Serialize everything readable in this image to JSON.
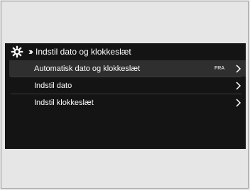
{
  "header": {
    "title": "Indstil dato og klokkeslæt",
    "icon": "gear-icon",
    "nav_icon": "double-chevron-icon"
  },
  "items": [
    {
      "label": "Automatisk dato og klokkeslæt",
      "value": "FRA"
    },
    {
      "label": "Indstil dato",
      "value": ""
    },
    {
      "label": "Indstil klokkeslæt",
      "value": ""
    }
  ],
  "colors": {
    "background": "#e6e6e6",
    "screen": "#141414",
    "highlight": "#2f2f2f",
    "text": "#ffffff"
  }
}
